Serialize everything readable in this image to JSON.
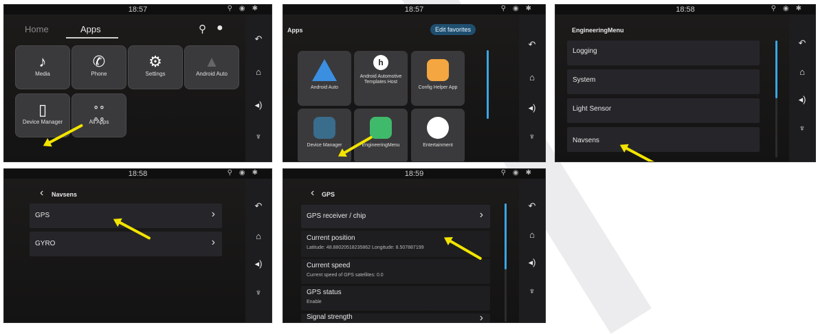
{
  "status_bar": {
    "icons": [
      "location-icon",
      "signal-icon",
      "bluetooth-icon"
    ]
  },
  "rail": {
    "icons": [
      "back-icon",
      "home-icon",
      "volume-icon",
      "microphone-icon"
    ]
  },
  "accent_color": "#3aa6e6",
  "panel1": {
    "time": "18:57",
    "tabs": {
      "home": "Home",
      "apps": "Apps"
    },
    "tiles": [
      "Media",
      "Phone",
      "Settings",
      "Android Auto",
      "Device Manager",
      "All Apps"
    ]
  },
  "panel2": {
    "time": "18:57",
    "title": "Apps",
    "edit_button": "Edit favorites",
    "tiles": [
      "Android Auto",
      "Android Automotive Templates Host",
      "Config Helper App",
      "Device Manager",
      "EngineeringMenu",
      "Entertainment"
    ]
  },
  "panel3": {
    "time": "18:58",
    "title": "EngineeringMenu",
    "items": [
      "Logging",
      "System",
      "Light Sensor",
      "Navsens"
    ]
  },
  "panel4": {
    "time": "18:58",
    "title": "Navsens",
    "items": [
      "GPS",
      "GYRO"
    ]
  },
  "panel5": {
    "time": "18:59",
    "title": "GPS",
    "items": [
      {
        "title": "GPS receiver / chip",
        "sub": ""
      },
      {
        "title": "Current position",
        "sub": "Latitude: 48.88020518235862 Longitude: 8.507887199"
      },
      {
        "title": "Current speed",
        "sub": "Current speed of GPS satellites: 0.0"
      },
      {
        "title": "GPS status",
        "sub": "Enable"
      },
      {
        "title": "Signal strength",
        "sub": ""
      }
    ]
  }
}
